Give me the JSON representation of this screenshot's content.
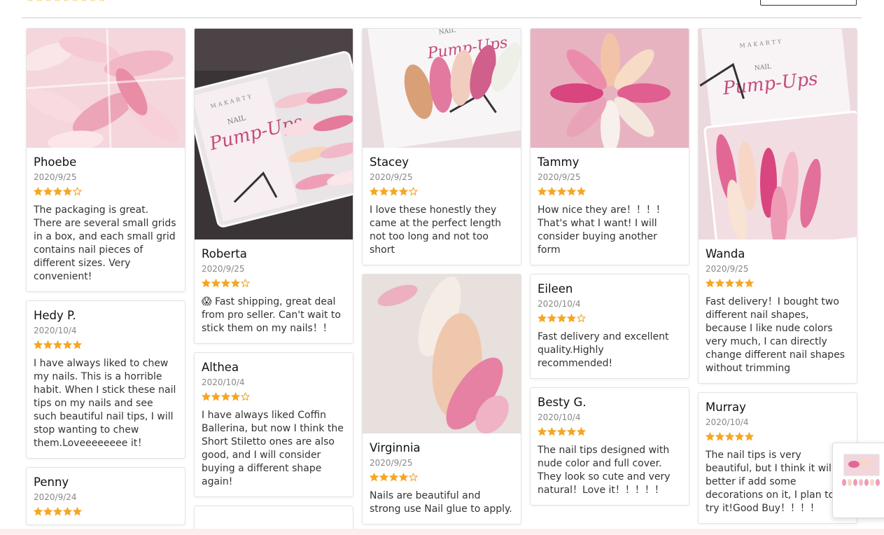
{
  "colors": {
    "star": "#f5a623",
    "star_empty": "#f5a623",
    "text": "#333333",
    "accent_bg": "#fbeeed"
  },
  "reviews": [
    {
      "name": "Phoebe",
      "date": "2020/9/25",
      "rating": 4,
      "text": "The packaging is great. There are several small grids in a box, and each small grid contains nail pieces of different sizes. Very convenient!"
    },
    {
      "name": "Hedy P.",
      "date": "2020/10/4",
      "rating": 5,
      "text": "I have always liked to chew my nails. This is a horrible habit. When I stick these nail tips on my nails and see such beautiful nail tips, I will stop wanting to chew them.Loveeeeeeee it！"
    },
    {
      "name": "Penny",
      "date": "2020/9/24",
      "rating": 5,
      "text": ""
    },
    {
      "name": "Roberta",
      "date": "2020/9/25",
      "rating": 4,
      "text": "😱 Fast shipping, great deal from pro seller. Can't wait to stick them on my nails！！"
    },
    {
      "name": "Althea",
      "date": "2020/10/4",
      "rating": 4,
      "text": "I have always liked Coffin Ballerina, but now I think the Short Stiletto ones are also good, and I will consider buying a different shape again!"
    },
    {
      "name": "Stacey",
      "date": "2020/9/25",
      "rating": 4,
      "text": "I love these honestly they came at the perfect length not too long and not too short"
    },
    {
      "name": "Virginnia",
      "date": "2020/9/25",
      "rating": 4,
      "text": "Nails are beautiful and strong use Nail glue to apply."
    },
    {
      "name": "Tammy",
      "date": "2020/9/25",
      "rating": 5,
      "text": "How nice they are！！！！ That's what I want! I will consider buying another form"
    },
    {
      "name": "Eileen",
      "date": "2020/10/4",
      "rating": 4,
      "text": "Fast delivery and excellent quality.Highly recommended!"
    },
    {
      "name": "Besty G.",
      "date": "2020/10/4",
      "rating": 5,
      "text": "The nail tips designed with nude color and full cover. They look so cute and very natural！Love it！！！！！"
    },
    {
      "name": "Wanda",
      "date": "2020/9/25",
      "rating": 5,
      "text": "Fast delivery！I bought two different nail shapes, because I like nude colors very much, I can directly change different nail shapes without trimming"
    },
    {
      "name": "Murray",
      "date": "2020/10/4",
      "rating": 5,
      "text": "The nail tips is very beautiful, but I think it will be better if add some decorations on it, I plan to try it!Good Buy！！！！"
    }
  ],
  "box_label": {
    "brand": "MAKARTY",
    "line": "NAIL",
    "title": "Pump-Ups"
  }
}
